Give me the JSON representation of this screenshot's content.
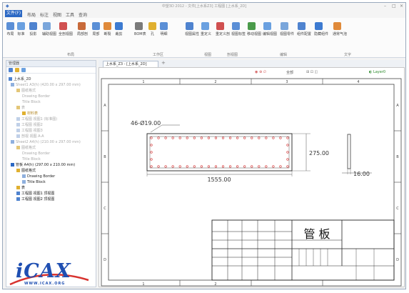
{
  "app": {
    "title": "中望3D 2012 - 文件[上水系Z3]  工程图 [上水系_2D]"
  },
  "menu": {
    "start": "文件(F)",
    "items": [
      "布局",
      "标注",
      "视图",
      "工具",
      "查询"
    ]
  },
  "ribbon": {
    "tools": [
      "布局",
      "标准",
      "投影",
      "辅助视图",
      "全剖视图",
      "局部剖",
      "局部",
      "断裂",
      "裁剪",
      "BOM表",
      "孔",
      "明细",
      "视图属性",
      "重定义",
      "重定义剖",
      "视图标签",
      "移动视图",
      "编辑视图",
      "视图零件",
      "组件配置",
      "隐藏组件",
      "通常气泡"
    ],
    "groups": [
      "布局",
      "工作区",
      "视图",
      "剖视图",
      "编辑",
      "文字"
    ]
  },
  "sidebar": {
    "title": "管理器",
    "tree": [
      "上水系_2D",
      "Sheet1 A3(h) (420.00 x 297.00 mm)",
      "图纸格式",
      "Drawing Border",
      "Title Block",
      "表",
      "材料表",
      "工程图 视图1 (标准图)",
      "工程图 视图2",
      "工程图 视图3",
      "剖视 视图 A-A",
      "Sheet2 A4(h) (210.00 x 297.00 mm)",
      "图纸格式",
      "Drawing Border",
      "Title Block",
      "管板 A4(h) (297.00 x 210.00 mm)",
      "图纸格式",
      "Drawing Border",
      "Title Block",
      "表",
      "工程图 视图1 顶视图",
      "工程图 视图2 顶视图"
    ]
  },
  "document": {
    "tab_label": "上水系_Z3 - [上水系_2D]",
    "toolbar": [
      "全部",
      "Layer0"
    ],
    "columns": [
      "1",
      "2",
      "3",
      "4"
    ],
    "rows": [
      "A",
      "B",
      "C",
      "D"
    ],
    "dimensions": {
      "holes": "46-Ø19.00",
      "height": "275.00",
      "width": "1555.00",
      "thickness": "16.00"
    },
    "title_block": {
      "part_name": "管 板"
    }
  },
  "logo": {
    "text": "iCAX",
    "url": "WWW.ICAX.ORG"
  },
  "colors": {
    "accent": "#2b68c4",
    "hole_red": "#d43030",
    "logo_blue": "#1f4fb2"
  }
}
